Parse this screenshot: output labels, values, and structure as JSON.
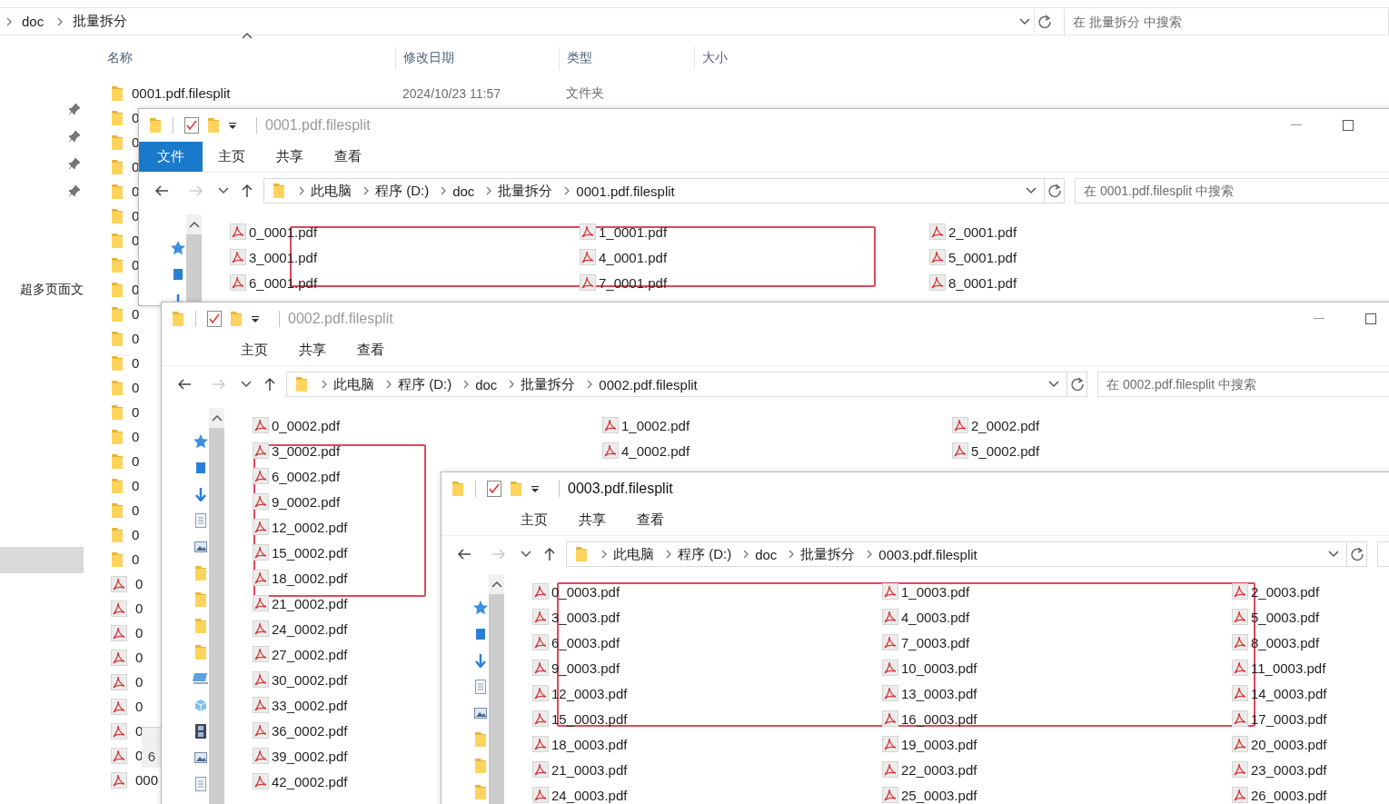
{
  "explorer": {
    "address": [
      "doc",
      "批量拆分"
    ],
    "search_placeholder": "在 批量拆分 中搜索",
    "nav_text": "超多页面文",
    "columns": [
      {
        "label": "名称",
        "sorted": true
      },
      {
        "label": "修改日期",
        "sorted": false
      },
      {
        "label": "类型",
        "sorted": false
      },
      {
        "label": "大小",
        "sorted": false
      }
    ],
    "rows": [
      {
        "kind": "folder",
        "name": "0001.pdf.filesplit",
        "modified": "2024/10/23 11:57",
        "type": "文件夹"
      },
      {
        "kind": "folder",
        "name": "0"
      },
      {
        "kind": "folder",
        "name": "0"
      },
      {
        "kind": "folder",
        "name": "0"
      },
      {
        "kind": "folder",
        "name": "0"
      },
      {
        "kind": "folder",
        "name": "0"
      },
      {
        "kind": "folder",
        "name": "0"
      },
      {
        "kind": "folder",
        "name": "0"
      },
      {
        "kind": "folder",
        "name": "0"
      },
      {
        "kind": "folder",
        "name": "0"
      },
      {
        "kind": "folder",
        "name": "0"
      },
      {
        "kind": "folder",
        "name": "0"
      },
      {
        "kind": "folder",
        "name": "0"
      },
      {
        "kind": "folder",
        "name": "0"
      },
      {
        "kind": "folder",
        "name": "0"
      },
      {
        "kind": "folder",
        "name": "0"
      },
      {
        "kind": "folder",
        "name": "0"
      },
      {
        "kind": "folder",
        "name": "0"
      },
      {
        "kind": "folder",
        "name": "0"
      },
      {
        "kind": "folder",
        "name": "0"
      },
      {
        "kind": "pdf",
        "name": "0"
      },
      {
        "kind": "pdf",
        "name": "0"
      },
      {
        "kind": "pdf",
        "name": "0"
      },
      {
        "kind": "pdf",
        "name": "0"
      },
      {
        "kind": "pdf",
        "name": "0"
      },
      {
        "kind": "pdf",
        "name": "0"
      },
      {
        "kind": "pdf",
        "name": "0"
      },
      {
        "kind": "pdf",
        "name": "0"
      },
      {
        "kind": "pdf",
        "name": "000"
      }
    ],
    "fragment": "6"
  },
  "windows": [
    {
      "title": "0001.pdf.filesplit",
      "active": false,
      "controls_visible": true,
      "tabs": [
        {
          "label": "文件",
          "kind": "file"
        },
        {
          "label": "主页",
          "kind": "tab"
        },
        {
          "label": "共享",
          "kind": "tab"
        },
        {
          "label": "查看",
          "kind": "tab"
        }
      ],
      "address": [
        "此电脑",
        "程序 (D:)",
        "doc",
        "批量拆分",
        "0001.pdf.filesplit"
      ],
      "search_placeholder": "在 0001.pdf.filesplit 中搜索",
      "file_columns": [
        [
          "0_0001.pdf",
          "3_0001.pdf",
          "6_0001.pdf"
        ],
        [
          "1_0001.pdf",
          "4_0001.pdf",
          "7_0001.pdf"
        ],
        [
          "2_0001.pdf",
          "5_0001.pdf",
          "8_0001.pdf"
        ]
      ]
    },
    {
      "title": "0002.pdf.filesplit",
      "active": false,
      "controls_visible": true,
      "tabs": [
        {
          "label": "主页",
          "kind": "tab"
        },
        {
          "label": "共享",
          "kind": "tab"
        },
        {
          "label": "查看",
          "kind": "tab"
        }
      ],
      "address": [
        "此电脑",
        "程序 (D:)",
        "doc",
        "批量拆分",
        "0002.pdf.filesplit"
      ],
      "search_placeholder": "在 0002.pdf.filesplit 中搜索",
      "file_columns": [
        [
          "0_0002.pdf",
          "3_0002.pdf",
          "6_0002.pdf",
          "9_0002.pdf",
          "12_0002.pdf",
          "15_0002.pdf",
          "18_0002.pdf",
          "21_0002.pdf",
          "24_0002.pdf",
          "27_0002.pdf",
          "30_0002.pdf",
          "33_0002.pdf",
          "36_0002.pdf",
          "39_0002.pdf",
          "42_0002.pdf"
        ],
        [
          "1_0002.pdf",
          "4_0002.pdf"
        ],
        [
          "2_0002.pdf",
          "5_0002.pdf"
        ]
      ]
    },
    {
      "title": "0003.pdf.filesplit",
      "active": true,
      "controls_visible": false,
      "tabs": [
        {
          "label": "主页",
          "kind": "tab"
        },
        {
          "label": "共享",
          "kind": "tab"
        },
        {
          "label": "查看",
          "kind": "tab"
        }
      ],
      "address": [
        "此电脑",
        "程序 (D:)",
        "doc",
        "批量拆分",
        "0003.pdf.filesplit"
      ],
      "file_columns": [
        [
          "0_0003.pdf",
          "3_0003.pdf",
          "6_0003.pdf",
          "9_0003.pdf",
          "12_0003.pdf",
          "15_0003.pdf",
          "18_0003.pdf",
          "21_0003.pdf",
          "24_0003.pdf"
        ],
        [
          "1_0003.pdf",
          "4_0003.pdf",
          "7_0003.pdf",
          "10_0003.pdf",
          "13_0003.pdf",
          "16_0003.pdf",
          "19_0003.pdf",
          "22_0003.pdf",
          "25_0003.pdf"
        ],
        [
          "2_0003.pdf",
          "5_0003.pdf",
          "8_0003.pdf",
          "11_0003.pdf",
          "14_0003.pdf",
          "17_0003.pdf",
          "20_0003.pdf",
          "23_0003.pdf",
          "26_0003.pdf"
        ]
      ]
    }
  ]
}
